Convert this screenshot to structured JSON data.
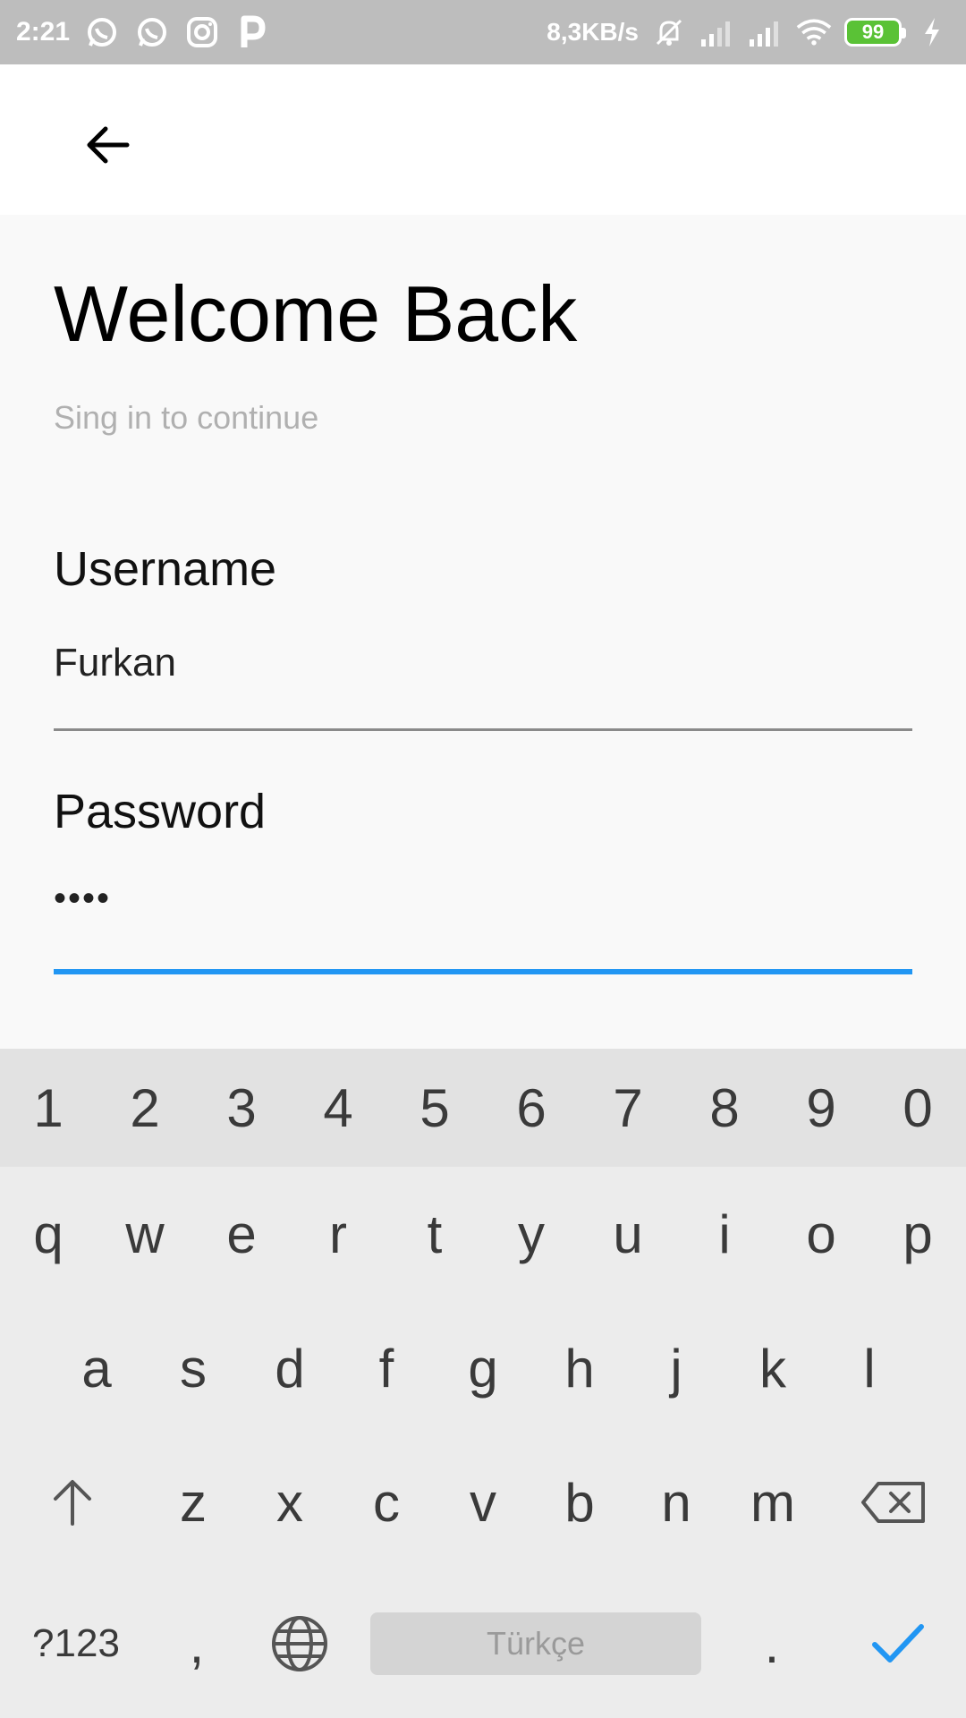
{
  "status_bar": {
    "time": "2:21",
    "notification_icons": [
      "whatsapp-icon",
      "whatsapp-icon",
      "instagram-icon",
      "p-app-icon"
    ],
    "net_speed": "8,3KB/s",
    "battery": "99",
    "battery_color": "#5ac236"
  },
  "app_bar": {
    "back_icon": "arrow-left-icon"
  },
  "login": {
    "title": "Welcome Back",
    "subtitle": "Sing in to continue",
    "username_label": "Username",
    "username_value": "Furkan",
    "password_label": "Password",
    "password_value": "••••",
    "focus_color": "#2196f3"
  },
  "keyboard": {
    "numbers": [
      "1",
      "2",
      "3",
      "4",
      "5",
      "6",
      "7",
      "8",
      "9",
      "0"
    ],
    "row1": [
      "q",
      "w",
      "e",
      "r",
      "t",
      "y",
      "u",
      "i",
      "o",
      "p"
    ],
    "row2": [
      "a",
      "s",
      "d",
      "f",
      "g",
      "h",
      "j",
      "k",
      "l"
    ],
    "row3": [
      "z",
      "x",
      "c",
      "v",
      "b",
      "n",
      "m"
    ],
    "symbols_label": "?123",
    "comma": ",",
    "space_label": "Türkçe",
    "period": ".",
    "done_color": "#2196f3"
  }
}
